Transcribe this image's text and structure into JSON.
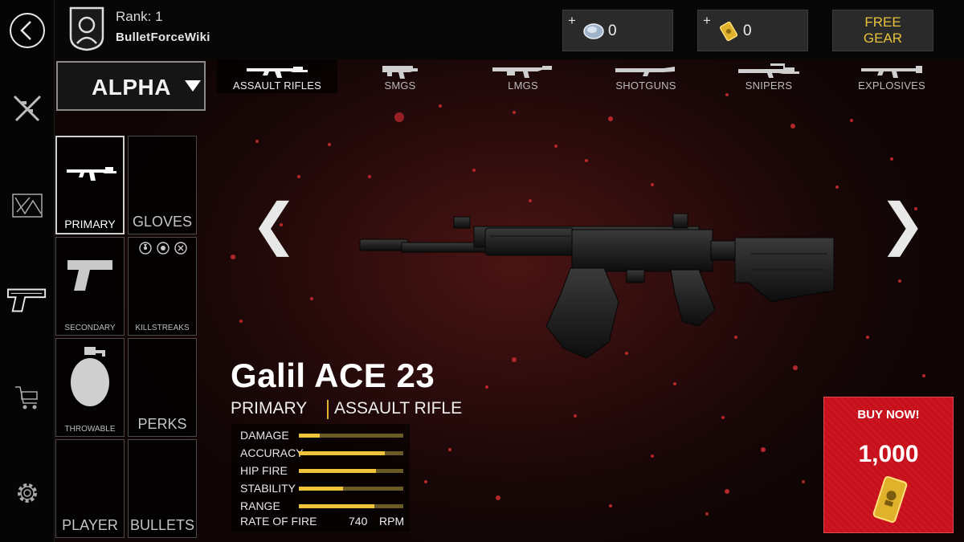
{
  "header": {
    "rank_text": "Rank: 1",
    "username": "BulletForceWiki",
    "credits": {
      "plus": "+",
      "amount": "0",
      "icon": "credits-icon"
    },
    "gold": {
      "plus": "+",
      "amount": "0",
      "icon": "gold-bar-icon"
    },
    "free_gear": {
      "line1": "FREE",
      "line2": "GEAR"
    }
  },
  "sidebar": {
    "items": [
      {
        "icon": "back-icon"
      },
      {
        "icon": "crossed-rifles-icon"
      },
      {
        "icon": "map-icon"
      },
      {
        "icon": "pistol-icon"
      },
      {
        "icon": "cart-icon"
      },
      {
        "icon": "gear-icon"
      }
    ]
  },
  "loadout": {
    "name": "ALPHA"
  },
  "categories": [
    {
      "label": "ASSAULT RIFLES",
      "active": true
    },
    {
      "label": "SMGS",
      "active": false
    },
    {
      "label": "LMGS",
      "active": false
    },
    {
      "label": "SHOTGUNS",
      "active": false
    },
    {
      "label": "SNIPERS",
      "active": false
    },
    {
      "label": "EXPLOSIVES",
      "active": false
    }
  ],
  "slots": {
    "primary": "PRIMARY",
    "gloves": "GLOVES",
    "secondary": "SECONDARY",
    "killstreaks": "KILLSTREAKS",
    "throwable": "THROWABLE",
    "perks": "PERKS",
    "player": "PLAYER",
    "bullets": "BULLETS"
  },
  "carousel": {
    "prev": "❮",
    "next": "❯"
  },
  "weapon": {
    "name": "Galil ACE 23",
    "slot": "PRIMARY",
    "class": "ASSAULT RIFLE",
    "stats": [
      {
        "label": "DAMAGE",
        "value": 0.2
      },
      {
        "label": "ACCURACY",
        "value": 0.82
      },
      {
        "label": "HIP FIRE",
        "value": 0.74
      },
      {
        "label": "STABILITY",
        "value": 0.42
      },
      {
        "label": "RANGE",
        "value": 0.72
      }
    ],
    "rate_of_fire": {
      "label": "RATE OF FIRE",
      "value": "740",
      "unit": "RPM"
    }
  },
  "buy": {
    "title": "BUY NOW!",
    "price": "1,000",
    "icon": "gold-bar-icon"
  },
  "colors": {
    "accent_gold": "#f0c43a",
    "buy_red": "#c8101c",
    "free_gear_text": "#e8c23c"
  }
}
